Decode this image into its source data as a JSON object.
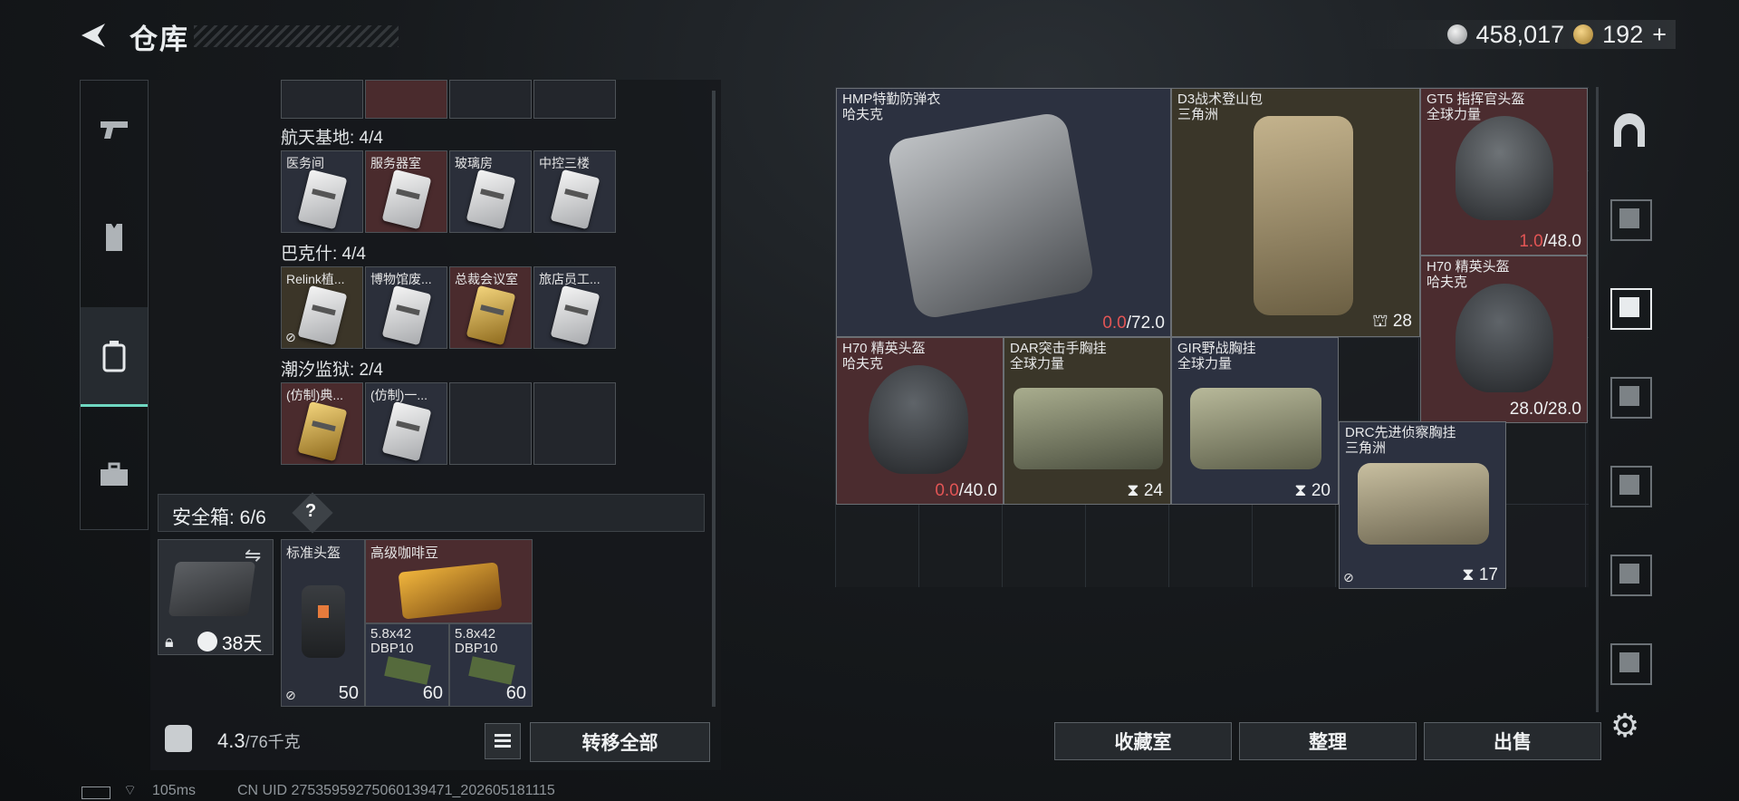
{
  "header": {
    "title": "仓库",
    "currency": [
      {
        "icon": "silver-coin-icon",
        "value": "458,017"
      },
      {
        "icon": "gold-coin-icon",
        "value": "192"
      }
    ],
    "add_symbol": "+"
  },
  "rail": [
    {
      "icon": "pistol-icon"
    },
    {
      "icon": "vest-icon"
    },
    {
      "icon": "backpack-icon",
      "active": true
    },
    {
      "icon": "toolbox-icon"
    }
  ],
  "keycards": {
    "groups": [
      {
        "label": "航天基地: 4/4",
        "items": [
          {
            "name": "医务间",
            "style": "blue"
          },
          {
            "name": "服务器室",
            "style": "red"
          },
          {
            "name": "玻璃房",
            "style": "blue"
          },
          {
            "name": "中控三楼",
            "style": "blue"
          }
        ]
      },
      {
        "label": "巴克什: 4/4",
        "items": [
          {
            "name": "Relink植...",
            "style": "gold"
          },
          {
            "name": "博物馆废...",
            "style": "blue"
          },
          {
            "name": "总裁会议室",
            "style": "red"
          },
          {
            "name": "旅店员工...",
            "style": "blue"
          }
        ]
      },
      {
        "label": "潮汐监狱: 2/4",
        "items": [
          {
            "name": "(仿制)典...",
            "style": "red"
          },
          {
            "name": "(仿制)一...",
            "style": "blue"
          }
        ]
      }
    ]
  },
  "safebox": {
    "title": "安全箱: 6/6",
    "help": "?",
    "days": "38天",
    "items": [
      {
        "name": "标准头盔",
        "stat": "50"
      },
      {
        "name": "高级咖啡豆"
      },
      {
        "name": "5.8x42 DBP10",
        "count": "60"
      },
      {
        "name": "5.8x42 DBP10",
        "count": "60"
      }
    ]
  },
  "footer_left": {
    "weight": "4.3",
    "weight_max": "/76千克",
    "transfer_label": "转移全部"
  },
  "stash": {
    "items": [
      {
        "name": "HMP特勤防弹衣",
        "brand": "哈夫克",
        "dur_cur": "0.0",
        "dur_max": "/72.0"
      },
      {
        "name": "D3战术登山包",
        "brand": "三角洲",
        "stat": "28"
      },
      {
        "name": "GT5 指挥官头盔",
        "brand": "全球力量",
        "dur_cur": "1.0",
        "dur_max": "/48.0"
      },
      {
        "name": "H70 精英头盔",
        "brand": "哈夫克",
        "dur_full": "28.0/28.0"
      },
      {
        "name": "H70 精英头盔",
        "brand": "哈夫克",
        "dur_cur": "0.0",
        "dur_max": "/40.0"
      },
      {
        "name": "DAR突击手胸挂",
        "brand": "全球力量",
        "stat": "24"
      },
      {
        "name": "GIR野战胸挂",
        "brand": "全球力量",
        "stat": "20"
      },
      {
        "name": "DRC先进侦察胸挂",
        "brand": "三角洲",
        "stat": "17"
      }
    ]
  },
  "buttons": {
    "collection": "收藏室",
    "sort": "整理",
    "sell": "出售"
  },
  "status": {
    "ping": "105ms",
    "uid": "CN UID 2753595927506013947​1_202605181115"
  }
}
